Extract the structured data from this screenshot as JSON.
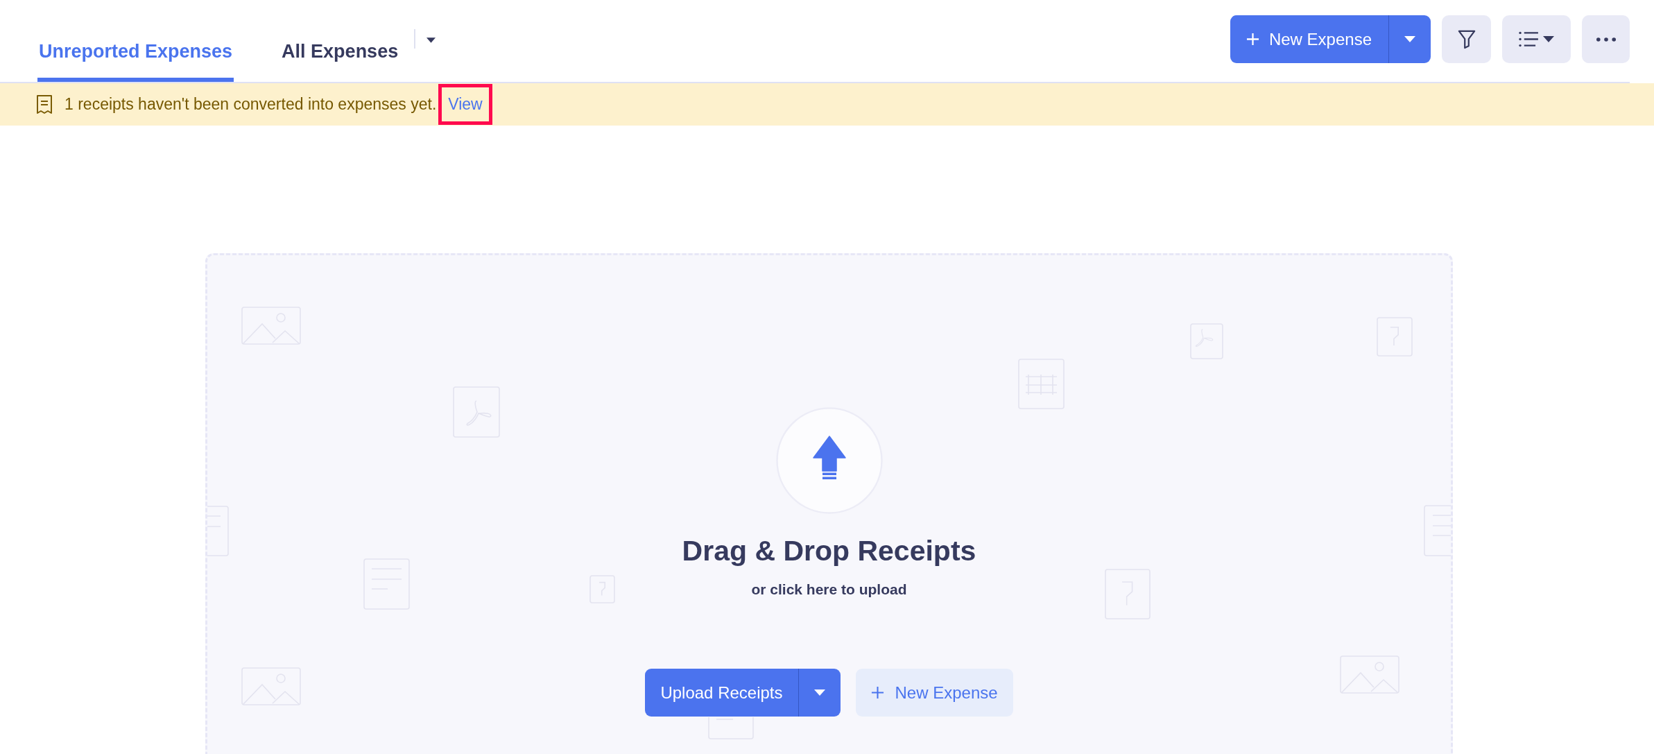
{
  "tabs": [
    {
      "label": "Unreported Expenses",
      "selected": true
    },
    {
      "label": "All Expenses",
      "selected": false
    }
  ],
  "toolbar": {
    "new_expense_button": {
      "label": "New Expense"
    }
  },
  "banner": {
    "message": "1 receipts haven't been converted into expenses yet.",
    "link": {
      "label": "View",
      "highlighted": true
    }
  },
  "drop_zone": {
    "title": "Drag & Drop Receipts",
    "subtitle": "or click here to upload",
    "upload_button": {
      "label": "Upload Receipts"
    },
    "new_expense_button": {
      "label": "New Expense"
    }
  }
}
